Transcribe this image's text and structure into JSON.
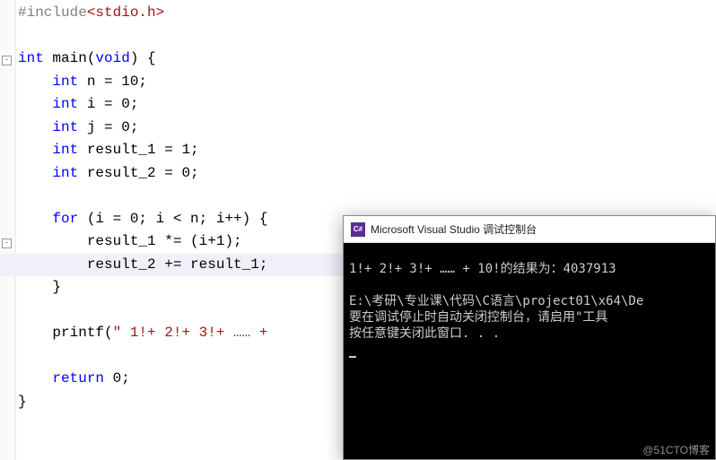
{
  "code": {
    "l1": {
      "pp": "#include",
      "inc": "<stdio.h>"
    },
    "l3_int": "int",
    "l3_main": " main(",
    "l3_void": "void",
    "l3_rest": ") {",
    "l4_int": "int",
    "l4_rest": " n = 10;",
    "l5_int": "int",
    "l5_rest": " i = 0;",
    "l6_int": "int",
    "l6_rest": " j = 0;",
    "l7_int": "int",
    "l7_rest": " result_1 = 1;",
    "l8_int": "int",
    "l8_rest": " result_2 = 0;",
    "l10_for": "for",
    "l10_rest": " (i = 0; i < n; i++) {",
    "l11": "        result_1 *= (i+1);",
    "l12": "        result_2 += result_1;",
    "l13": "    }",
    "l15_a": "    printf(",
    "l15_str": "\" 1!+ 2!+ 3!+ …… + ",
    "l17_ret": "return",
    "l17_rest": " 0;",
    "l18": "}"
  },
  "console": {
    "title": "Microsoft Visual Studio 调试控制台",
    "out1": "1!+ 2!+ 3!+ …… + 10!的结果为：4037913",
    "out2": "E:\\考研\\专业课\\代码\\C语言\\project01\\x64\\De",
    "out3": "要在调试停止时自动关闭控制台，请启用\"工具",
    "out4": "按任意键关闭此窗口. . .",
    "icon_text": "C#"
  },
  "watermark": "@51CTO博客"
}
